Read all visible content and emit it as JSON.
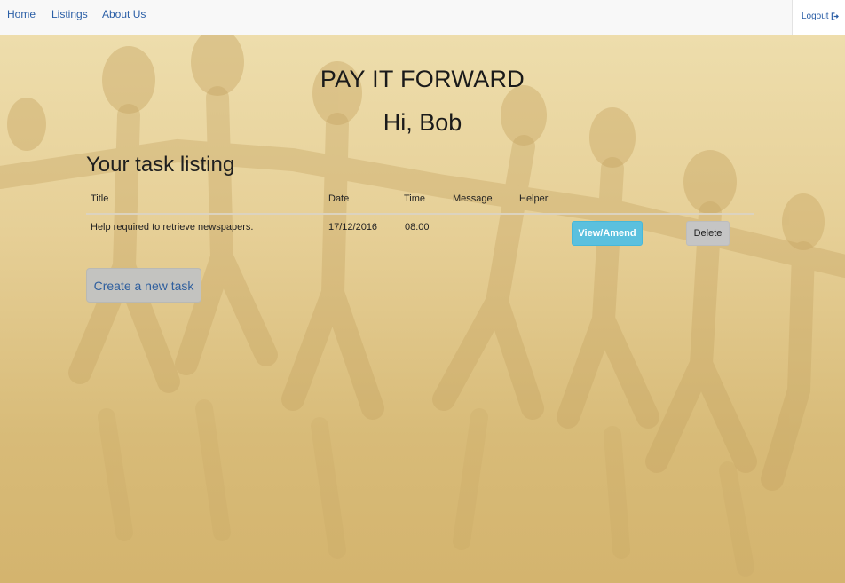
{
  "nav": {
    "items": [
      {
        "label": "Home"
      },
      {
        "label": "Listings"
      },
      {
        "label": "About Us"
      }
    ],
    "logout_label": "Logout",
    "logout_icon": "logout-icon"
  },
  "page": {
    "site_title": "PAY IT FORWARD",
    "greeting": "Hi, Bob",
    "section_title": "Your task listing"
  },
  "table": {
    "headers": [
      "Title",
      "Date",
      "Time",
      "Message",
      "Helper"
    ],
    "rows": [
      {
        "title": "Help required to retrieve newspapers.",
        "date": "17/12/2016",
        "time": "08:00",
        "message": "",
        "helper": "",
        "view_label": "View/Amend",
        "delete_label": "Delete"
      }
    ]
  },
  "actions": {
    "create_label": "Create a new task"
  },
  "colors": {
    "link": "#2a5ea6",
    "view_button": "#5bc0de",
    "delete_button": "#c5c5c5",
    "create_button": "#c3c3c0",
    "background": "#e6cf96"
  }
}
